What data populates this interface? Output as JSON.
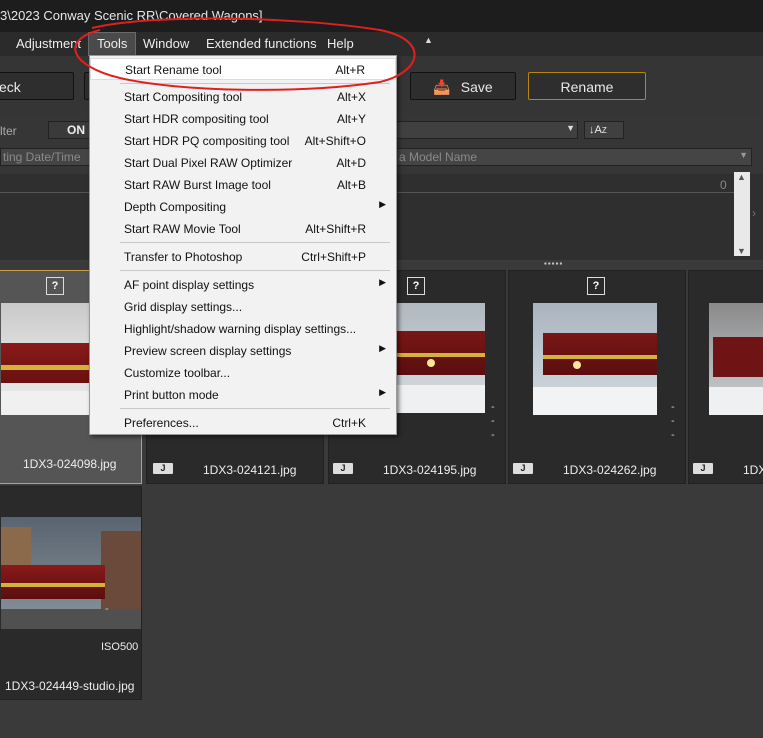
{
  "title": "3\\2023 Conway Scenic RR\\Covered Wagons]",
  "menubar": {
    "items": [
      "Adjustment",
      "Tools",
      "Window",
      "Extended functions",
      "Help"
    ]
  },
  "toolbar": {
    "check_label": "eck",
    "save_label": "Save",
    "rename_label": "Rename"
  },
  "filter": {
    "label": "lter",
    "on_label": "ON",
    "sort_label": "A",
    "sort_sub": "Z",
    "col1": "ting Date/Time",
    "col2": "a Model Name",
    "count": "0"
  },
  "tools_menu": {
    "items": [
      {
        "label": "Start Rename tool",
        "shortcut": "Alt+R"
      },
      {
        "label": "Start Compositing tool",
        "shortcut": "Alt+X"
      },
      {
        "label": "Start HDR compositing tool",
        "shortcut": "Alt+Y"
      },
      {
        "label": "Start HDR PQ compositing tool",
        "shortcut": "Alt+Shift+O"
      },
      {
        "label": "Start Dual Pixel RAW Optimizer",
        "shortcut": "Alt+D"
      },
      {
        "label": "Start RAW Burst Image tool",
        "shortcut": "Alt+B"
      },
      {
        "label": "Depth Compositing",
        "shortcut": ""
      },
      {
        "label": "Start RAW Movie Tool",
        "shortcut": "Alt+Shift+R"
      },
      {
        "label": "Transfer to Photoshop",
        "shortcut": "Ctrl+Shift+P"
      },
      {
        "label": "AF point display settings",
        "shortcut": ""
      },
      {
        "label": "Grid display settings...",
        "shortcut": ""
      },
      {
        "label": "Highlight/shadow warning display settings...",
        "shortcut": ""
      },
      {
        "label": "Preview screen display settings",
        "shortcut": ""
      },
      {
        "label": "Customize toolbar...",
        "shortcut": ""
      },
      {
        "label": "Print button mode",
        "shortcut": ""
      },
      {
        "label": "Preferences...",
        "shortcut": "Ctrl+K"
      }
    ]
  },
  "thumbnails": [
    {
      "file": "1DX3-024098.jpg",
      "badge": "?"
    },
    {
      "file": "1DX3-024121.jpg",
      "badge": "?",
      "type": "J"
    },
    {
      "file": "1DX3-024195.jpg",
      "badge": "?",
      "type": "J"
    },
    {
      "file": "1DX3-024262.jpg",
      "badge": "?",
      "type": "J"
    },
    {
      "file": "1DX",
      "badge": "?",
      "type": "J"
    },
    {
      "file": "1DX3-024449-studio.jpg",
      "iso": "ISO500"
    }
  ],
  "colors": {
    "accent": "#c9a24a",
    "annotation": "#e02020"
  }
}
